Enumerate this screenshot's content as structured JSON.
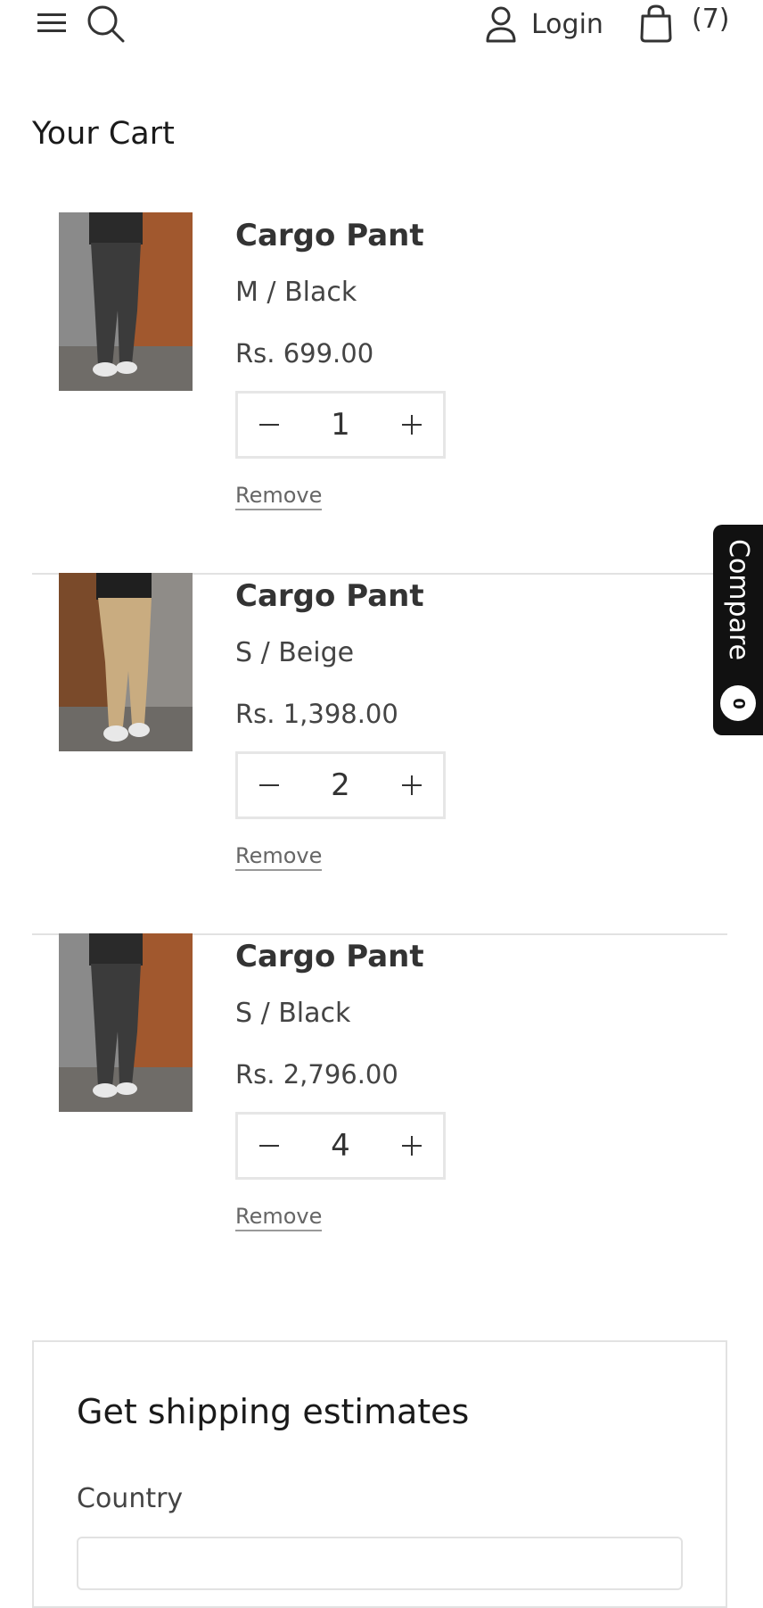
{
  "header": {
    "login_label": "Login",
    "cart_count": "(7)",
    "icons": [
      "menu-icon",
      "search-icon",
      "user-icon",
      "bag-icon"
    ]
  },
  "page_title": "Your Cart",
  "items": [
    {
      "title": "Cargo Pant",
      "variant": "M / Black",
      "price": "Rs. 699.00",
      "quantity": "1",
      "remove_label": "Remove",
      "image_color": "#3b3b3b"
    },
    {
      "title": "Cargo Pant",
      "variant": "S / Beige",
      "price": "Rs. 1,398.00",
      "quantity": "2",
      "remove_label": "Remove",
      "image_color": "#c9ac80"
    },
    {
      "title": "Cargo Pant",
      "variant": "S / Black",
      "price": "Rs. 2,796.00",
      "quantity": "4",
      "remove_label": "Remove",
      "image_color": "#3b3b3b"
    }
  ],
  "compare": {
    "label": "Compare",
    "count": "0"
  },
  "shipping": {
    "title": "Get shipping estimates",
    "country_label": "Country"
  },
  "colors": {
    "text": "#333333",
    "border": "#e2e2e2",
    "compare_bg": "#111111"
  }
}
